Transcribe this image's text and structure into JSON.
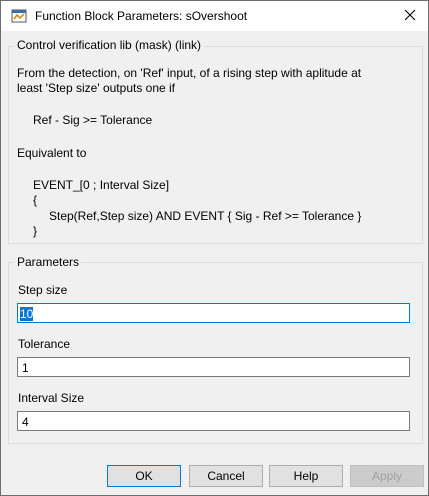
{
  "window": {
    "title": "Function Block Parameters: sOvershoot",
    "app_icon": "simulink-icon",
    "close_icon": "close-icon"
  },
  "mask_group": {
    "title": "Control verification lib (mask) (link)",
    "description": [
      "From the detection, on 'Ref' input, of a rising step with aplitude at",
      "least 'Step size' outputs one if",
      "Ref - Sig >= Tolerance",
      "Equivalent to",
      "EVENT_[0 ; Interval Size]",
      "{",
      "Step(Ref,Step size) AND EVENT { Sig - Ref >= Tolerance }",
      "}"
    ]
  },
  "parameters_group": {
    "title": "Parameters",
    "fields": [
      {
        "label": "Step size",
        "value": "10"
      },
      {
        "label": "Tolerance",
        "value": "1"
      },
      {
        "label": "Interval Size",
        "value": "4"
      }
    ]
  },
  "buttons": {
    "ok": "OK",
    "cancel": "Cancel",
    "help": "Help",
    "apply": "Apply"
  }
}
